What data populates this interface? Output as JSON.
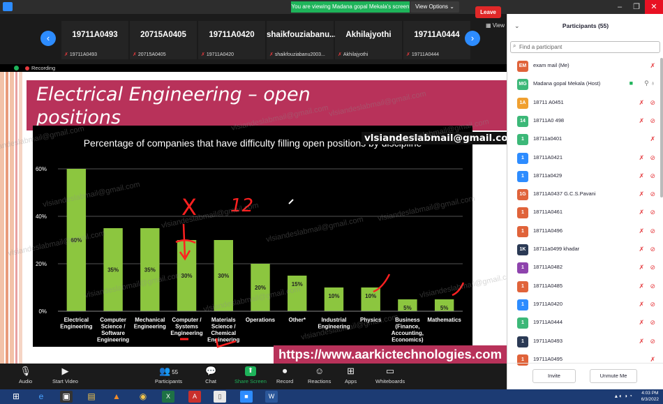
{
  "window": {
    "viewing_banner": "You are viewing Madana gopal Mekala's screen",
    "view_options": "View Options ⌄",
    "controls": [
      "–",
      "❐",
      "✕"
    ]
  },
  "thumbnails": [
    {
      "name": "19711A0493",
      "sub": "19711A0493"
    },
    {
      "name": "20715A0405",
      "sub": "20715A0405"
    },
    {
      "name": "19711A0420",
      "sub": "19711A0420"
    },
    {
      "name": "shaikfouziabanu...",
      "sub": "shaikfouziabanu2003..."
    },
    {
      "name": "Akhilajyothi",
      "sub": "Akhilajyothi"
    },
    {
      "name": "19711A0444",
      "sub": "19711A0444"
    }
  ],
  "view_label": "View",
  "recording_label": "Recording",
  "slide": {
    "title": "Electrical Engineering – open positions",
    "email_banner": "vlsiandeslabmail@gmail.com",
    "url_banner": "https://www.aarkictechnologies.com",
    "watermark": "vlsiandeslabmail@gmail.com",
    "annotations": {
      "x_mark": "X",
      "num": "12"
    }
  },
  "chart_data": {
    "type": "bar",
    "title": "Percentage of companies that have difficulty filling open positions by discipline",
    "categories": [
      "Electrical Engineering",
      "Computer Science / Software Engineering",
      "Mechanical Engineering",
      "Computer / Systems Engineering",
      "Materials Science / Chemical Engineering",
      "Operations",
      "Other*",
      "Industrial Engineering",
      "Physics",
      "Business (Finance, Accounting, Economics)",
      "Mathematics"
    ],
    "category_lines": [
      [
        "Electrical",
        "Engineering"
      ],
      [
        "Computer",
        "Science /",
        "Software",
        "Engineering"
      ],
      [
        "Mechanical",
        "Engineering"
      ],
      [
        "Computer /",
        "Systems",
        "Engineering"
      ],
      [
        "Materials",
        "Science /",
        "Chemical",
        "Engineering"
      ],
      [
        "Operations"
      ],
      [
        "Other*"
      ],
      [
        "Industrial",
        "Engineering"
      ],
      [
        "Physics"
      ],
      [
        "Business",
        "(Finance,",
        "Accounting,",
        "Economics)"
      ],
      [
        "Mathematics"
      ]
    ],
    "values": [
      60,
      35,
      35,
      30,
      30,
      20,
      15,
      10,
      10,
      5,
      5
    ],
    "value_labels": [
      "60%",
      "35%",
      "35%",
      "30%",
      "30%",
      "20%",
      "15%",
      "10%",
      "10%",
      "5%",
      "5%"
    ],
    "yticks": [
      "0%",
      "20%",
      "40%",
      "60%"
    ],
    "ylim": [
      0,
      60
    ],
    "bar_color": "#8cc63f",
    "grid": true
  },
  "toolbar": {
    "items": [
      {
        "icon": "🎙",
        "label": "Audio"
      },
      {
        "icon": "▶",
        "label": "Start Video"
      },
      {
        "icon": "👥",
        "label": "Participants",
        "badge": "55"
      },
      {
        "icon": "💬",
        "label": "Chat"
      },
      {
        "icon": "⬆",
        "label": "Share Screen"
      },
      {
        "icon": "⏺",
        "label": "Record"
      },
      {
        "icon": "☺",
        "label": "Reactions"
      },
      {
        "icon": "⊞",
        "label": "Apps"
      },
      {
        "icon": "▭",
        "label": "Whiteboards"
      }
    ],
    "leave": "Leave"
  },
  "participants": {
    "title": "Participants (55)",
    "search_placeholder": "Find a participant",
    "list": [
      {
        "initials": "EM",
        "color": "#e0633a",
        "name": "exam mail (Me)",
        "cam": false
      },
      {
        "initials": "MG",
        "color": "#3cb878",
        "name": "Madana gopal Mekala (Host)",
        "host": true,
        "cam": false
      },
      {
        "initials": "1A",
        "color": "#f0a030",
        "name": "18711 A0451",
        "cam": true
      },
      {
        "initials": "14",
        "color": "#3cb878",
        "name": "18711A0 498",
        "cam": true
      },
      {
        "initials": "1",
        "color": "#3cb878",
        "name": "18711a0401",
        "cam": false
      },
      {
        "initials": "1",
        "color": "#2d8cff",
        "name": "18711A0421",
        "cam": true
      },
      {
        "initials": "1",
        "color": "#2d8cff",
        "name": "18711a0429",
        "cam": true
      },
      {
        "initials": "1G",
        "color": "#e0633a",
        "name": "18711A0437 G.C.S.Pavani",
        "cam": true
      },
      {
        "initials": "1",
        "color": "#e0633a",
        "name": "18711A0461",
        "cam": true
      },
      {
        "initials": "1",
        "color": "#e0633a",
        "name": "18711A0496",
        "cam": true
      },
      {
        "initials": "1K",
        "color": "#2b3a55",
        "name": "18711a0499 khadar",
        "cam": true
      },
      {
        "initials": "1",
        "color": "#8e44ad",
        "name": "18711A0482",
        "cam": true
      },
      {
        "initials": "1",
        "color": "#e0633a",
        "name": "18711A0485",
        "cam": true
      },
      {
        "initials": "1",
        "color": "#2d8cff",
        "name": "19711A0420",
        "cam": true
      },
      {
        "initials": "1",
        "color": "#3cb878",
        "name": "19711A0444",
        "cam": true
      },
      {
        "initials": "1",
        "color": "#2b3a55",
        "name": "19711A0493",
        "cam": true
      },
      {
        "initials": "1",
        "color": "#e0633a",
        "name": "19711A0495",
        "cam": false
      }
    ],
    "invite": "Invite",
    "unmute_me": "Unmute Me"
  },
  "taskbar": {
    "time": "4:03 PM",
    "date": "6/3/2022"
  }
}
